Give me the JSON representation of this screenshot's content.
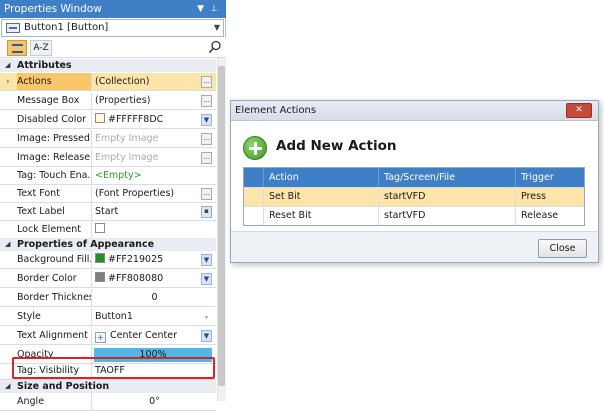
{
  "properties_window": {
    "title": "Properties Window",
    "title_buttons": [
      "▼",
      "⊥",
      "✕"
    ],
    "selected_object": "Button1 [Button]",
    "toolbar": {
      "az_label": "A-Z"
    },
    "sections": {
      "attributes": "Attributes",
      "appearance": "Properties of Appearance",
      "size_position": "Size and Position"
    },
    "rows": {
      "actions": {
        "name": "Actions",
        "value": "(Collection)"
      },
      "message_box": {
        "name": "Message Box",
        "value": "(Properties)"
      },
      "disabled_color": {
        "name": "Disabled Color",
        "value": "#FFFFF8DC",
        "swatch": "#FFF8DC"
      },
      "image_pressed": {
        "name": "Image: Pressed...",
        "value": "Empty Image"
      },
      "image_released": {
        "name": "Image: Release...",
        "value": "Empty Image"
      },
      "tag_touch": {
        "name": "Tag: Touch Ena...",
        "value": "<Empty>"
      },
      "text_font": {
        "name": "Text Font",
        "value": "(Font Properties)"
      },
      "text_label": {
        "name": "Text Label",
        "value": "Start"
      },
      "lock_element": {
        "name": "Lock Element",
        "value": ""
      },
      "background_fill": {
        "name": "Background Fill...",
        "value": "#FF219025",
        "swatch": "#219025"
      },
      "border_color": {
        "name": "Border Color",
        "value": "#FF808080",
        "swatch": "#808080"
      },
      "border_thickness": {
        "name": "Border Thickness",
        "value": "0"
      },
      "style": {
        "name": "Style",
        "value": "Button1"
      },
      "text_alignment": {
        "name": "Text Alignment",
        "value": "Center Center"
      },
      "opacity": {
        "name": "Opacity",
        "value": "100%",
        "level": 1.0
      },
      "tag_visibility": {
        "name": "Tag: Visibility",
        "value": "TAOFF"
      },
      "angle": {
        "name": "Angle",
        "value": "0°"
      }
    }
  },
  "element_actions_dialog": {
    "title": "Element Actions",
    "close_x": "✕",
    "add_action_label": "Add New Action",
    "columns": [
      "Action",
      "Tag/Screen/File",
      "Trigger"
    ],
    "rows": [
      {
        "action": "Set Bit",
        "tag": "startVFD",
        "trigger": "Press"
      },
      {
        "action": "Reset Bit",
        "tag": "startVFD",
        "trigger": "Release"
      }
    ],
    "close_button": "Close"
  },
  "colors": {
    "title_blue": "#3f7fc6",
    "selection_orange": "#fac66a",
    "highlight_red": "#e21f26",
    "opacity_bar": "#4fb7e3"
  }
}
